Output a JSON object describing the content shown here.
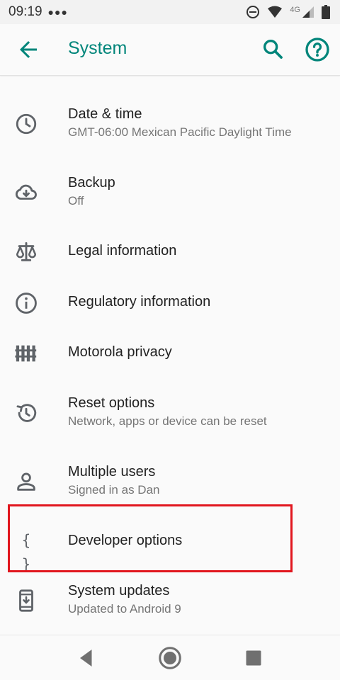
{
  "status_bar": {
    "time": "09:19",
    "network": "4G"
  },
  "app_bar": {
    "title": "System"
  },
  "items": [
    {
      "title": "Date & time",
      "subtitle": "GMT-06:00 Mexican Pacific Daylight Time",
      "icon": "clock-icon"
    },
    {
      "title": "Backup",
      "subtitle": "Off",
      "icon": "cloud-download-icon"
    },
    {
      "title": "Legal information",
      "icon": "scales-icon"
    },
    {
      "title": "Regulatory information",
      "icon": "info-icon"
    },
    {
      "title": "Motorola privacy",
      "icon": "fence-icon"
    },
    {
      "title": "Reset options",
      "subtitle": "Network, apps or device can be reset",
      "icon": "history-icon"
    },
    {
      "title": "Multiple users",
      "subtitle": "Signed in as Dan",
      "icon": "person-icon"
    },
    {
      "title": "Developer options",
      "icon": "braces-icon",
      "highlighted": true
    },
    {
      "title": "System updates",
      "subtitle": "Updated to Android 9",
      "icon": "phone-update-icon"
    }
  ],
  "colors": {
    "accent": "#00857a",
    "highlight": "#e1161e",
    "icon": "#5f6368"
  }
}
